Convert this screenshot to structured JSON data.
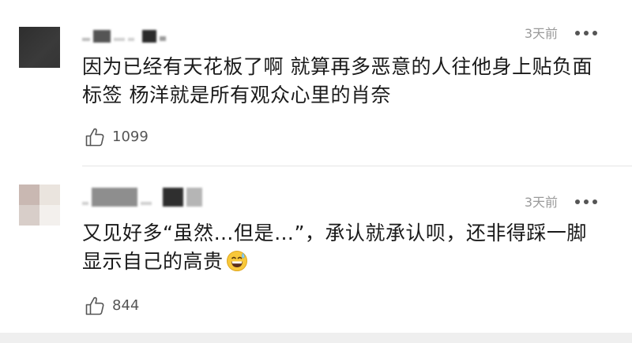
{
  "comments": [
    {
      "time": "3天前",
      "text": "因为已经有天花板了啊 就算再多恶意的人往他身上贴负面标签 杨洋就是所有观众心里的肖奈",
      "likes": "1099"
    },
    {
      "time": "3天前",
      "text": "又见好多“虽然…但是…”，承认就承认呗，还非得踩一脚显示自己的高贵",
      "emoji": "grinning-face-with-sweat-icon",
      "likes": "844"
    }
  ],
  "colors": {
    "text": "#1a1a1a",
    "meta": "#9a9a9a",
    "divider": "#e6e6e6",
    "footer_bar": "#efefef"
  },
  "icons": {
    "like": "thumbs-up-icon",
    "more": "more-dots-icon"
  }
}
